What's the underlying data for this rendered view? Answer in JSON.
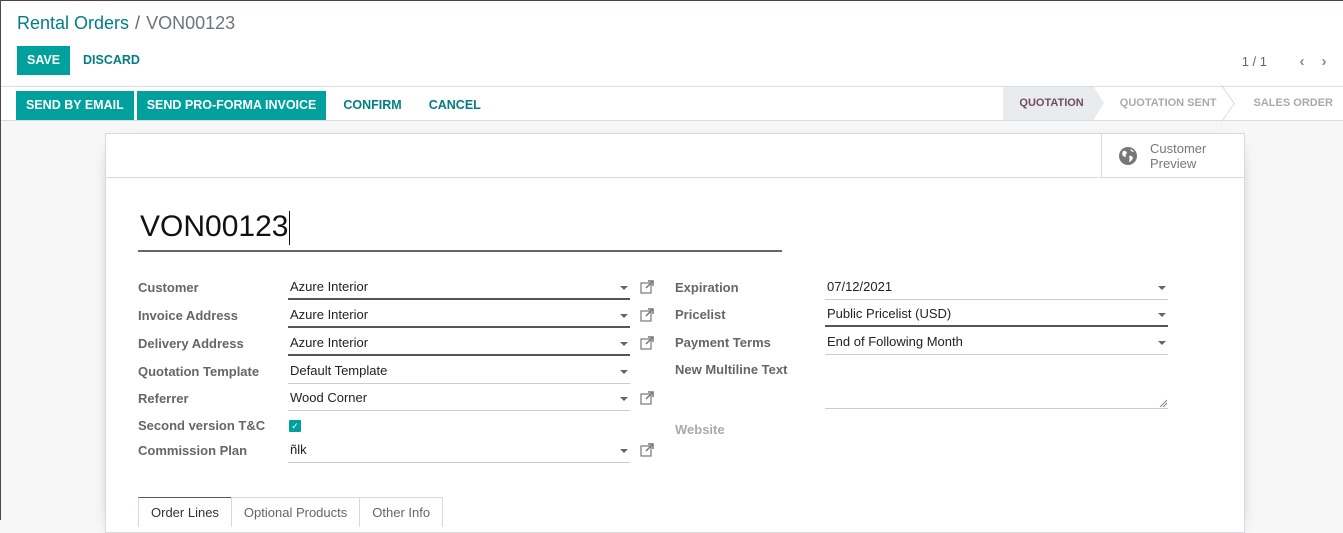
{
  "breadcrumb": {
    "parent": "Rental Orders",
    "separator": "/",
    "current": "VON00123"
  },
  "toolbar": {
    "save_label": "SAVE",
    "discard_label": "DISCARD"
  },
  "pager": {
    "value": "1 / 1",
    "prev_icon": "chevron-left-icon",
    "next_icon": "chevron-right-icon"
  },
  "actions": {
    "send_email": "SEND BY EMAIL",
    "send_proforma": "SEND PRO-FORMA INVOICE",
    "confirm": "CONFIRM",
    "cancel": "CANCEL"
  },
  "stages": [
    {
      "label": "QUOTATION",
      "active": true
    },
    {
      "label": "QUOTATION SENT",
      "active": false
    },
    {
      "label": "SALES ORDER",
      "active": false
    }
  ],
  "button_box": {
    "customer_preview_line1": "Customer",
    "customer_preview_line2": "Preview",
    "icon": "globe-icon"
  },
  "record": {
    "name": "VON00123"
  },
  "left_fields": {
    "customer": {
      "label": "Customer",
      "value": "Azure Interior"
    },
    "invoice_address": {
      "label": "Invoice Address",
      "value": "Azure Interior"
    },
    "delivery_address": {
      "label": "Delivery Address",
      "value": "Azure Interior"
    },
    "quotation_template": {
      "label": "Quotation Template",
      "value": "Default Template"
    },
    "referrer": {
      "label": "Referrer",
      "value": "Wood Corner"
    },
    "second_version_tc": {
      "label": "Second version T&C",
      "checked": true
    },
    "commission_plan": {
      "label": "Commission Plan",
      "value": "ñlk"
    }
  },
  "right_fields": {
    "expiration": {
      "label": "Expiration",
      "value": "07/12/2021"
    },
    "pricelist": {
      "label": "Pricelist",
      "value": "Public Pricelist (USD)"
    },
    "payment_terms": {
      "label": "Payment Terms",
      "value": "End of Following Month"
    },
    "new_multiline_text": {
      "label": "New Multiline Text",
      "value": ""
    },
    "website": {
      "label": "Website"
    }
  },
  "tabs": [
    {
      "label": "Order Lines",
      "active": true
    },
    {
      "label": "Optional Products",
      "active": false
    },
    {
      "label": "Other Info",
      "active": false
    }
  ],
  "colors": {
    "primary": "#00a09d",
    "link": "#017e84",
    "brand": "#714b67"
  }
}
